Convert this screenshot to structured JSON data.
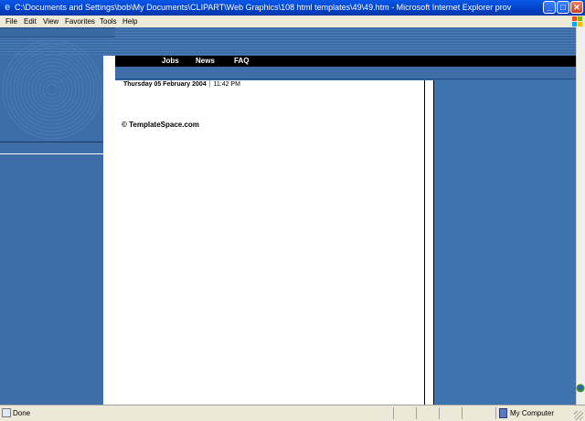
{
  "window": {
    "title": "C:\\Documents and Settings\\bob\\My Documents\\CLIPART\\Web Graphics\\108 html templates\\49\\49.htm - Microsoft Internet Explorer prov",
    "minimize_glyph": "_",
    "maximize_glyph": "□",
    "close_glyph": "✕"
  },
  "menu": {
    "items": [
      "File",
      "Edit",
      "View",
      "Favorites",
      "Tools",
      "Help"
    ]
  },
  "nav": {
    "links": [
      "Jobs",
      "News",
      "FAQ"
    ]
  },
  "content": {
    "date": "Thursday 05 February 2004",
    "separator": "|",
    "time": "11:42 PM",
    "copyright": "© TemplateSpace.com"
  },
  "status": {
    "text": "Done",
    "zone": "My Computer"
  },
  "colors": {
    "titlebar": "#0a58e6",
    "page_blue": "#3d6ea8",
    "navbar": "#000000"
  },
  "icons": {
    "app": "internet-explorer-icon",
    "minimize": "minimize-icon",
    "maximize": "maximize-icon",
    "close": "close-icon",
    "windows_logo": "windows-logo-icon",
    "status_page": "page-icon",
    "zone": "computer-icon"
  }
}
